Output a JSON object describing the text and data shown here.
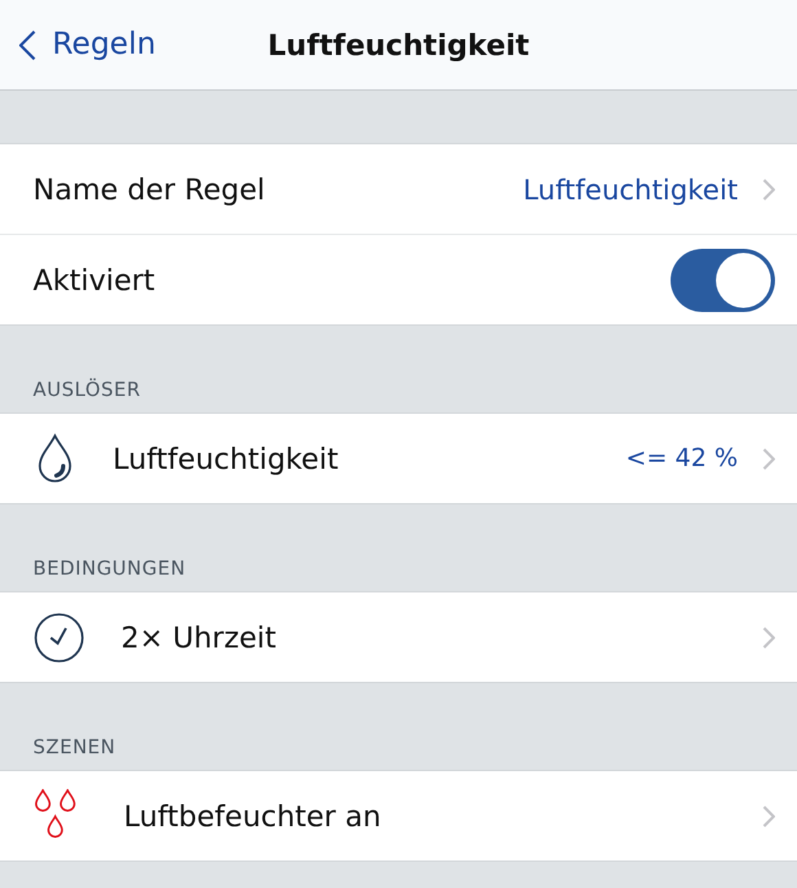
{
  "nav": {
    "back": "Regeln",
    "title": "Luftfeuchtigkeit"
  },
  "general": [
    {
      "kind": "link",
      "label": "Name der Regel",
      "value": "Luftfeuchtigkeit"
    },
    {
      "kind": "toggle",
      "label": "Aktiviert",
      "on": true
    }
  ],
  "sections": [
    {
      "header": "AUSLÖSER",
      "rows": [
        {
          "label": "Luftfeuchtigkeit",
          "value": "<= 42 %"
        }
      ]
    },
    {
      "header": "BEDINGUNGEN",
      "rows": [
        {
          "label": "2× Uhrzeit"
        }
      ]
    },
    {
      "header": "SZENEN",
      "rows": [
        {
          "label": "Luftbefeuchter an"
        }
      ]
    }
  ]
}
